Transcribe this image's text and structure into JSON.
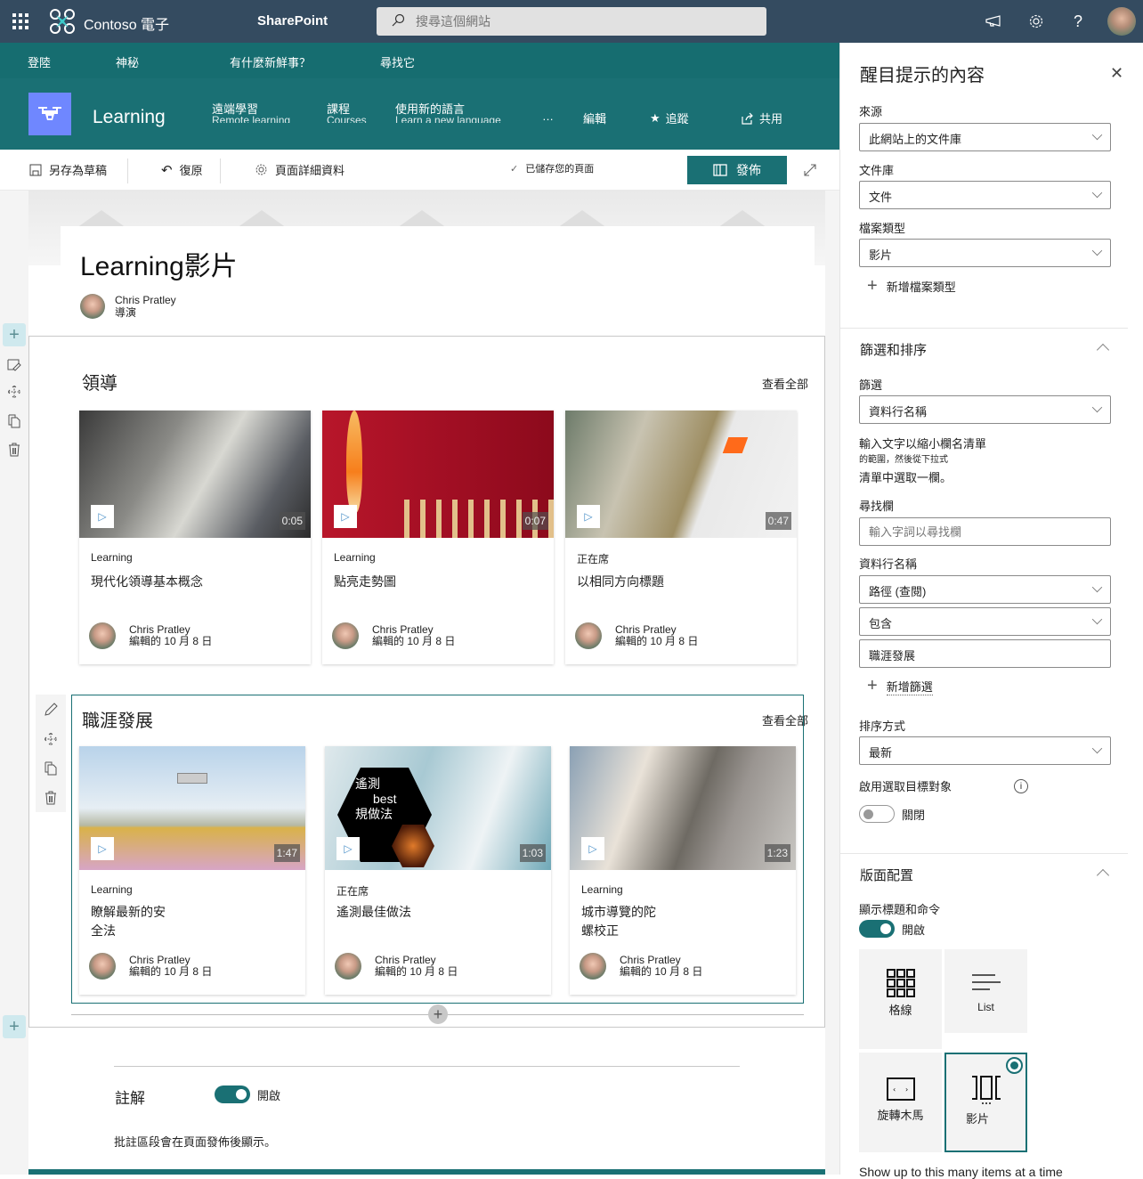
{
  "suitebar": {
    "brand": "Contoso 電子",
    "app": "SharePoint",
    "search_placeholder": "搜尋這個網站",
    "icons": [
      "waffle-icon",
      "megaphone-icon",
      "gear-icon",
      "help-icon"
    ],
    "help_glyph": "?"
  },
  "hubnav": {
    "items": [
      "登陸",
      "神秘",
      "有什麼新鮮事？",
      "尋找它"
    ]
  },
  "site": {
    "title": "Learning",
    "nav": [
      {
        "label": "遠端學習",
        "sub": "Remote learning"
      },
      {
        "label": "課程",
        "sub": "Courses"
      },
      {
        "label": "使用新的語言",
        "sub": "Learn a new language"
      }
    ],
    "more": "…",
    "edit": "編輯",
    "follow": "追蹤",
    "share": "共用"
  },
  "commandbar": {
    "save_draft": "另存為草稿",
    "undo": "復原",
    "page_details": "頁面詳細資料",
    "saved_status": "已儲存您的頁面",
    "publish": "發佈"
  },
  "page": {
    "title": "Learning影片",
    "author": {
      "name": "Chris Pratley",
      "role": "導演"
    }
  },
  "sections": [
    {
      "title": "領導",
      "see_all": "查看全部",
      "cards": [
        {
          "category": "Learning",
          "title": "現代化領導基本概念",
          "duration": "0:05",
          "author": "Chris Pratley",
          "edited": "編輯的 10 月 8 日"
        },
        {
          "category": "Learning",
          "title": "點亮走勢圖",
          "duration": "0:07",
          "author": "Chris Pratley",
          "edited": "編輯的 10 月 8 日"
        },
        {
          "category": "正在席",
          "title": "以相同方向標題",
          "duration": "0:47",
          "author": "Chris Pratley",
          "edited": "編輯的 10 月 8 日"
        }
      ]
    },
    {
      "title": "職涯發展",
      "see_all": "查看全部",
      "cards": [
        {
          "category": "Learning",
          "title": "瞭解最新的安全法",
          "duration": "1:47",
          "author": "Chris Pratley",
          "edited": "編輯的 10 月 8 日"
        },
        {
          "category": "正在席",
          "title": "遙測最佳做法",
          "duration": "1:03",
          "author": "Chris Pratley",
          "edited": "編輯的 10 月 8 日",
          "thumb_text": [
            "遙測",
            "best",
            "規做法"
          ]
        },
        {
          "category": "Learning",
          "title": "城市導覽的陀螺校正",
          "duration": "1:23",
          "author": "Chris Pratley",
          "edited": "編輯的 10 月 8 日"
        }
      ]
    }
  ],
  "comments": {
    "label": "註解",
    "toggle_state": "開啟",
    "toggle_on": true,
    "note": "批註區段會在頁面發佈後顯示。"
  },
  "panel": {
    "title": "醒目提示的內容",
    "source_label": "來源",
    "source_value": "此網站上的文件庫",
    "library_label": "文件庫",
    "library_value": "文件",
    "filetype_label": "檔案類型",
    "filetype_value": "影片",
    "add_filetype": "新增檔案類型",
    "filter_section": "篩選和排序",
    "filter_label": "篩選",
    "filter_value": "資料行名稱",
    "help_line1": "輸入文字以縮小欄名清單",
    "help_line2": "的範圍，然後從下拉式",
    "help_line3": "清單中選取一欄。",
    "find_label": "尋找欄",
    "find_placeholder": "輸入字詞以尋找欄",
    "column_label": "資料行名稱",
    "column_value": "路徑 (查閱)",
    "operator_value": "包含",
    "filter_text": "職涯發展",
    "add_filter": "新增篩選",
    "sort_label": "排序方式",
    "sort_value": "最新",
    "audience_label": "啟用選取目標對象",
    "audience_state": "關閉",
    "audience_on": false,
    "layout_section": "版面配置",
    "show_title_label": "顯示標題和命令",
    "show_title_state": "開啟",
    "show_title_on": true,
    "layouts": [
      {
        "label": "格線",
        "icon": "grid-icon",
        "selected": false
      },
      {
        "label": "List",
        "icon": "list-icon",
        "selected": false
      },
      {
        "label": "旋轉木馬",
        "icon": "carousel-icon",
        "selected": false
      },
      {
        "label": "影片",
        "icon": "filmstrip-icon",
        "selected": true
      }
    ],
    "items_label": "Show up to this many items at a time"
  },
  "colors": {
    "suitebar": "#344b60",
    "theme": "#1a7074",
    "hubnav": "#166d70",
    "site_logo": "#6f87ff"
  }
}
